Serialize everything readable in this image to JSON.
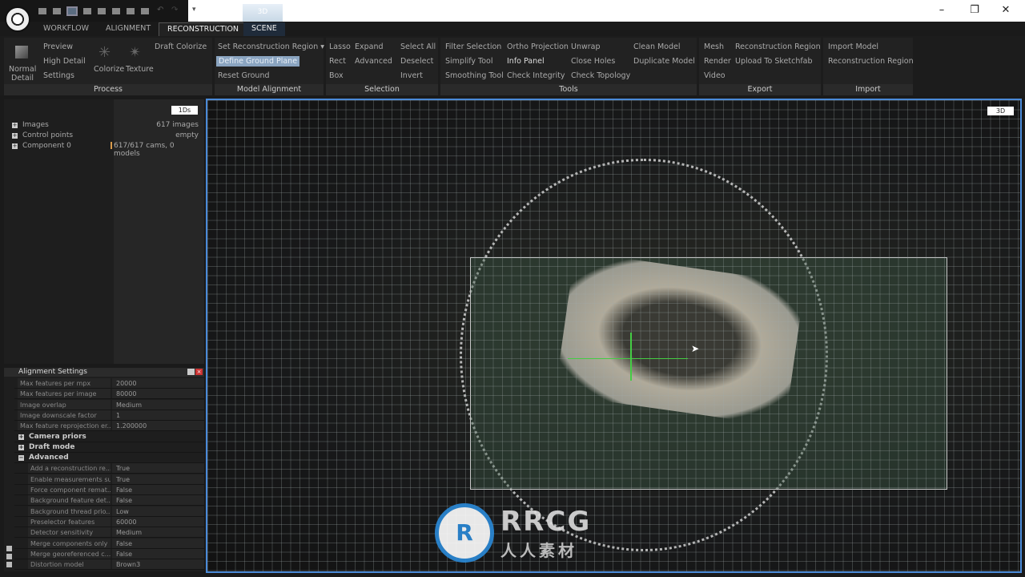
{
  "titlebar": {
    "view_tab": "3D",
    "rc_label": "RC",
    "help": "?"
  },
  "tabs": [
    "WORKFLOW",
    "ALIGNMENT",
    "RECONSTRUCTION",
    "SCENE"
  ],
  "ribbon": {
    "process": {
      "label": "Process",
      "normal_detail": "Normal Detail",
      "preview": "Preview",
      "high_detail": "High Detail",
      "settings": "Settings",
      "colorize": "Colorize",
      "texture": "Texture",
      "draft_colorize": "Draft Colorize"
    },
    "model_alignment": {
      "label": "Model Alignment",
      "set_region": "Set Reconstruction Region",
      "define_ground": "Define Ground Plane",
      "reset_ground": "Reset Ground"
    },
    "selection": {
      "label": "Selection",
      "lasso": "Lasso",
      "rect": "Rect",
      "box": "Box",
      "expand": "Expand",
      "advanced": "Advanced",
      "select_all": "Select All",
      "deselect": "Deselect",
      "invert": "Invert"
    },
    "tools": {
      "label": "Tools",
      "filter": "Filter Selection",
      "simplify": "Simplify Tool",
      "smoothing": "Smoothing Tool",
      "ortho": "Ortho Projection",
      "info": "Info Panel",
      "integrity": "Check Integrity",
      "unwrap": "Unwrap",
      "close_holes": "Close Holes",
      "topology": "Check Topology",
      "clean": "Clean Model",
      "duplicate": "Duplicate Model"
    },
    "export": {
      "label": "Export",
      "mesh": "Mesh",
      "render": "Render",
      "video": "Video",
      "region": "Reconstruction Region",
      "sketchfab": "Upload To Sketchfab"
    },
    "import": {
      "label": "Import",
      "model": "Import Model",
      "region": "Reconstruction Region"
    }
  },
  "project": {
    "view_button": "1Ds",
    "items": [
      {
        "name": "Images",
        "value": "617 images"
      },
      {
        "name": "Control points",
        "value": "empty"
      },
      {
        "name": "Component 0",
        "value": "617/617 cams, 0 models"
      }
    ]
  },
  "settings": {
    "title": "Alignment Settings",
    "rows": [
      {
        "k": "Max features per mpx",
        "v": "20000"
      },
      {
        "k": "Max features per image",
        "v": "80000"
      },
      {
        "k": "Image overlap",
        "v": "Medium"
      },
      {
        "k": "Image downscale factor",
        "v": "1"
      },
      {
        "k": "Max feature reprojection er...",
        "v": "1.200000"
      }
    ],
    "sections": [
      "Camera priors",
      "Draft mode",
      "Advanced"
    ],
    "advanced": [
      {
        "k": "Add a reconstruction re...",
        "v": "True"
      },
      {
        "k": "Enable measurements su...",
        "v": "True"
      },
      {
        "k": "Force component remat...",
        "v": "False"
      },
      {
        "k": "Background feature det...",
        "v": "False"
      },
      {
        "k": "Background thread prio...",
        "v": "Low"
      },
      {
        "k": "Preselector features",
        "v": "60000"
      },
      {
        "k": "Detector sensitivity",
        "v": "Medium"
      },
      {
        "k": "Merge components only",
        "v": "False"
      },
      {
        "k": "Merge georeferenced c...",
        "v": "False"
      },
      {
        "k": "Distortion model",
        "v": "Brown3"
      }
    ]
  },
  "viewport": {
    "view_button": "3D"
  },
  "watermark": {
    "logo": "RRCG",
    "text": "人人素材"
  }
}
